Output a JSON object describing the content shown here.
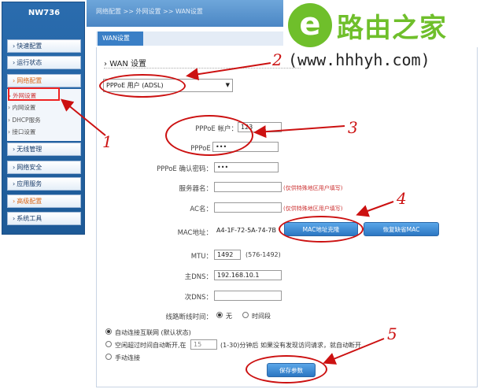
{
  "sidebar": {
    "brand": "NW736",
    "menu": [
      {
        "label": "快速配置",
        "color": "#1a3d6a"
      },
      {
        "label": "运行状态",
        "color": "#1a3d6a"
      },
      {
        "label": "网络配置",
        "color": "#d9691b"
      },
      {
        "label": "无线管理",
        "color": "#1a3d6a"
      },
      {
        "label": "网络安全",
        "color": "#1a3d6a"
      },
      {
        "label": "应用服务",
        "color": "#1a3d6a"
      },
      {
        "label": "高级配置",
        "color": "#d9691b"
      },
      {
        "label": "系统工具",
        "color": "#1a3d6a"
      }
    ],
    "submenu": [
      "外网设置",
      "内网设置",
      "DHCP服务",
      "接口设置"
    ]
  },
  "breadcrumb": "网络配置 >> 外网设置 >> WAN设置",
  "watermark": {
    "logo": "e",
    "title": "路由之家",
    "url": "(www.hhhyh.com)"
  },
  "tab": "WAN设置",
  "section_title": "WAN 设置",
  "connection_type": "PPPoE 用户 (ADSL)",
  "form": {
    "pppoe_account_label": "PPPoE 帐户：",
    "pppoe_account_value": "123",
    "pppoe_password_label": "PPPoE 密码：",
    "pppoe_password_value": "•••",
    "pppoe_confirm_label": "PPPoE 确认密码：",
    "pppoe_confirm_value": "•••",
    "server_name_label": "服务器名：",
    "server_name_hint": "(仅供特殊地区用户填写)",
    "ac_name_label": "AC名：",
    "ac_name_hint": "(仅供特殊地区用户填写)",
    "mac_label": "MAC地址：",
    "mac_value": "A4-1F-72-5A-74-7B",
    "mac_clone_button": "MAC地址克隆",
    "mac_restore_button": "恢复缺省MAC",
    "mtu_label": "MTU：",
    "mtu_value": "1492",
    "mtu_range": "(576-1492)",
    "dns1_label": "主DNS：",
    "dns1_value": "192.168.10.1",
    "dns2_label": "次DNS：",
    "dns2_value": "",
    "dial_time_label": "线路断线时间：",
    "dial_none": "无",
    "dial_period": "时间段"
  },
  "connect_modes": {
    "auto": "自动连接互联网 (默认状态)",
    "idle_prefix": "空闲超过时间自动断开,在",
    "idle_value": "15",
    "idle_suffix": "(1-30)分钟后 如果没有发现访问请求，就自动断开",
    "manual": "手动连接"
  },
  "save_button": "保存参数",
  "annotations": [
    "1",
    "2",
    "3",
    "4",
    "5"
  ],
  "annotation_color": "#cc1111"
}
